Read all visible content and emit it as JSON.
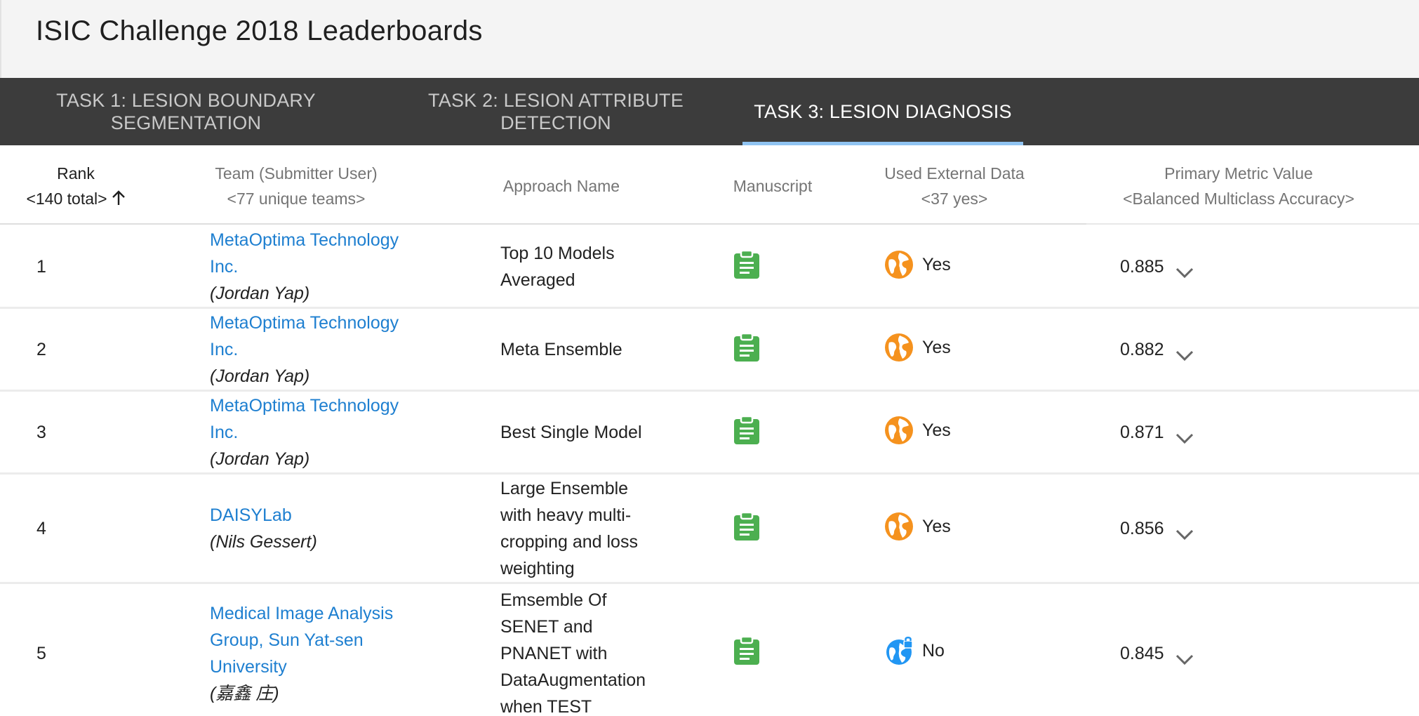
{
  "page": {
    "title": "ISIC Challenge 2018 Leaderboards"
  },
  "tabs": [
    {
      "label_line1": "Task 1: Lesion Boundary",
      "label_line2": "Segmentation"
    },
    {
      "label_line1": "Task 2: Lesion Attribute",
      "label_line2": "Detection"
    },
    {
      "label_line1": "Task 3: Lesion Diagnosis",
      "label_line2": ""
    }
  ],
  "active_tab_index": 2,
  "table": {
    "headers": {
      "rank": {
        "line1": "Rank",
        "line2": "<140 total>"
      },
      "team": {
        "line1": "Team (Submitter User)",
        "line2": "<77 unique teams>"
      },
      "approach": {
        "line1": "Approach Name"
      },
      "manuscript": {
        "line1": "Manuscript"
      },
      "external": {
        "line1": "Used External Data",
        "line2": "<37 yes>"
      },
      "metric": {
        "line1": "Primary Metric Value",
        "line2": "<Balanced Multiclass Accuracy>"
      }
    },
    "rows": [
      {
        "rank": "1",
        "team_line1": "MetaOptima Technology",
        "team_line2": "Inc.",
        "user": "(Jordan Yap)",
        "approach": [
          "Top 10 Models",
          "Averaged"
        ],
        "external": "Yes",
        "metric": "0.885"
      },
      {
        "rank": "2",
        "team_line1": "MetaOptima Technology",
        "team_line2": "Inc.",
        "user": "(Jordan Yap)",
        "approach": [
          "Meta Ensemble"
        ],
        "external": "Yes",
        "metric": "0.882"
      },
      {
        "rank": "3",
        "team_line1": "MetaOptima Technology",
        "team_line2": "Inc.",
        "user": "(Jordan Yap)",
        "approach": [
          "Best Single Model"
        ],
        "external": "Yes",
        "metric": "0.871"
      },
      {
        "rank": "4",
        "team_line1": "DAISYLab",
        "team_line2": "",
        "user": "(Nils Gessert)",
        "approach": [
          "Large Ensemble",
          "with heavy multi-",
          "cropping and loss",
          "weighting"
        ],
        "external": "Yes",
        "metric": "0.856"
      },
      {
        "rank": "5",
        "team_line1": "Medical Image Analysis",
        "team_line2": "Group, Sun Yat-sen",
        "team_line3": "University",
        "user": "(嘉鑫 庄)",
        "approach": [
          "Emsemble Of",
          "SENET and",
          "PNANET with",
          "DataAugmentation",
          "when TEST"
        ],
        "external": "No",
        "metric": "0.845"
      }
    ]
  },
  "colors": {
    "title_bar_bg": "#f4f4f4",
    "tab_bar_bg": "#3c3c3c",
    "active_tab_underline": "#90c4f2",
    "link": "#1e7fd0",
    "manuscript_icon": "#4caf50",
    "external_yes_icon": "#f5921e",
    "external_no_icon": "#2196f3"
  },
  "icons": {
    "manuscript": "clipboard-icon",
    "external_yes": "public-globe-icon",
    "external_no": "locked-globe-icon",
    "sort": "arrow-up-icon",
    "expand": "chevron-down-icon"
  }
}
